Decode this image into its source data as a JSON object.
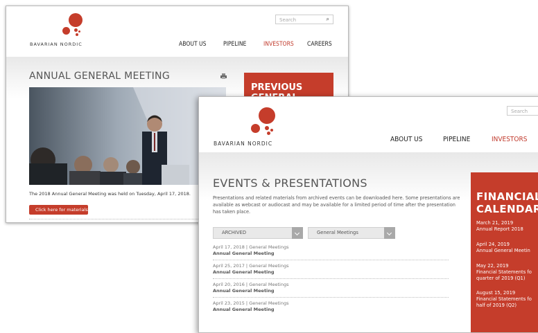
{
  "back_window": {
    "logo_text": "BAVARIAN NORDIC",
    "search_placeholder": "Search",
    "nav": [
      "ABOUT US",
      "PIPELINE",
      "INVESTORS",
      "CAREERS"
    ],
    "active_nav": "INVESTORS",
    "page_title": "ANNUAL GENERAL MEETING",
    "caption": "The 2018 Annual General Meeting was held on Tuesday, April 17, 2018.",
    "button_label": "Click here for materials",
    "side_panel_title_line1": "PREVIOUS",
    "side_panel_title_line2": "GENERAL"
  },
  "front_window": {
    "logo_text": "BAVARIAN NORDIC",
    "search_placeholder": "Search",
    "nav": [
      "ABOUT US",
      "PIPELINE",
      "INVESTORS"
    ],
    "active_nav": "INVESTORS",
    "page_title": "EVENTS & PRESENTATIONS",
    "intro": "Presentations and related materials from archived events can be downloaded here. Some presentations are available as webcast or audiocast and may be available for a limited period of time after the presentation has taken place.",
    "filter_status": "ARCHIVED",
    "filter_category": "General Meetings",
    "events": [
      {
        "meta": "April 17, 2018 | General Meetings",
        "name": "Annual General Meeting"
      },
      {
        "meta": "April 25, 2017 | General Meetings",
        "name": "Annual General Meeting"
      },
      {
        "meta": "April 20, 2016 | General Meetings",
        "name": "Annual General Meeting"
      },
      {
        "meta": "April 23, 2015 | General Meetings",
        "name": "Annual General Meeting"
      }
    ],
    "calendar": {
      "title_line1": "FINANCIAL",
      "title_line2": "CALENDAR",
      "items": [
        {
          "date": "March 21, 2019",
          "label": "Annual Report 2018"
        },
        {
          "date": "April 24, 2019",
          "label": "Annual General Meetin"
        },
        {
          "date": "May 22, 2019",
          "label": "Financial Statements fo",
          "label2": "quarter of 2019 (Q1)"
        },
        {
          "date": "August 15, 2019",
          "label": "Financial Statements fo",
          "label2": "half of 2019 (Q2)"
        }
      ]
    }
  },
  "colors": {
    "brand_red": "#c53d2b",
    "nav_active": "#c0392b",
    "dropdown_caret": "#a9a9a9"
  }
}
